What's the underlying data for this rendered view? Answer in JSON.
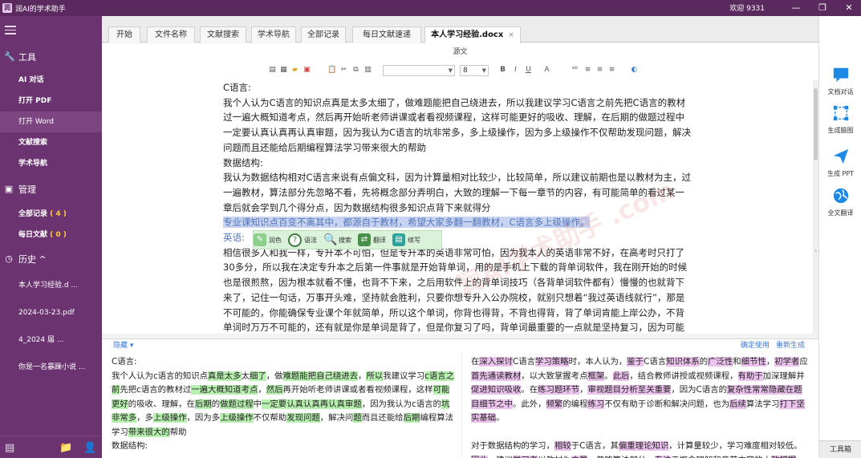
{
  "app": {
    "title": "润AI的学术助手",
    "logo_text": "润",
    "welcome": "欢迎 9331"
  },
  "sidebar": {
    "tools_header": "工具",
    "tools": [
      "AI 对话",
      "打开 PDF",
      "打开 Word",
      "文献搜索",
      "学术导航"
    ],
    "manage_header": "管理",
    "manage": [
      {
        "label": "全部记录",
        "count": "( 4 )"
      },
      {
        "label": "每日文献",
        "count": "( 0 )"
      }
    ],
    "history_header": "历史 ^",
    "history": [
      "本人学习经验.d ...",
      "2024-03-23.pdf",
      "4_2024 届 ...",
      "你是一名暴躁小说 ..."
    ]
  },
  "tabs": [
    {
      "label": "开始"
    },
    {
      "label": "文件名称"
    },
    {
      "label": "文献搜索"
    },
    {
      "label": "学术导航"
    },
    {
      "label": "全部记录"
    },
    {
      "label": "每日文献速递"
    },
    {
      "label": "本人学习经验.docx",
      "active": true,
      "close": "×"
    }
  ],
  "editor": {
    "source_label": "源文",
    "font_size": "8",
    "paragraphs": [
      "C语言:",
      "我个人认为C语言的知识点真是太多太细了，做难题能把自己绕进去，所以我建议学习C语言之前先把C语言的教材过一遍大概知道考点，然后再开始听老师讲课或者看视频课程，这样可能更好的吸收、理解，在后期的做题过程中一定要认真认真再认真审题，因为我认为C语言的坑非常多，多上级操作，因为多上级操作不仅帮助发现问题，解决问题而且还能给后期编程算法学习带来很大的帮助",
      "数据结构:",
      "我认为数据结构相对C语言来说有点偏文科，因为计算量相对比较少，比较简单，所以建议前期也是以教材为主，过一遍教材，算法部分先忽略不看，先将概念部分弄明白，大致的理解一下每一章节的内容，有可能简单的看过某一章后就会学到几个得分点，因为数据结构很多知识点背下来就得分"
    ],
    "selected": "专业课知识点百变不离其中，都源自于教材，希望大家多翻一翻教材，C语言多上级操作。",
    "english_heading": "英语:",
    "english_body": "相信很多人和我一样，专升本不可怕，但是专升本的英语非常可怕，因为我本人的英语非常不好，在高考时只打了30多分，所以我在决定专升本之后第一件事就是开始背单词，用的是手机上下载的背单词软件，我在刚开始的时候也是很煎熬，因为根本就看不懂，也背不下来，之后用软件上的背单词技巧（各背单词软件都有）慢慢的也就背下来了，记住一句话，万事开头难，坚持就会胜利，只要你想专升入公办院校，就别只想着“我过英语线就行”，那是不可能的，你能确保专业课个年就简单，所以这个单词，你背也得背，不背也得背，背了单词肯能上岸公办，不背单词时万万不可能的，还有就是你是单词是背了，但是你复习了吗，背单词最重要的一点就是坚持复习，因为可能今天背下来的单词",
    "watermark": "润AI学术助手 .com"
  },
  "popup": [
    {
      "label": "润色",
      "icon": "polish-icon",
      "color": "#6fbf6f"
    },
    {
      "label": "语法",
      "icon": "grammar-icon",
      "color": "#4a8f4a"
    },
    {
      "label": "搜索",
      "icon": "search-icon",
      "color": "#4a8f4a"
    },
    {
      "label": "翻译",
      "icon": "translate-icon",
      "color": "#4a8f4a"
    },
    {
      "label": "续写",
      "icon": "continue-icon",
      "color": "#2aa39a"
    }
  ],
  "compare": {
    "hide": "隐藏 ▾",
    "confirm": "确定使用",
    "regen": "重新生成"
  },
  "rpanel": {
    "items": [
      {
        "label": "文档对话",
        "icon": "chat-icon"
      },
      {
        "label": "生成脑图",
        "icon": "mindmap-icon"
      },
      {
        "label": "生成 PPT",
        "icon": "send-icon"
      },
      {
        "label": "全文翻译",
        "icon": "globe-icon"
      }
    ],
    "toolbox": "工具箱"
  },
  "colors": {
    "sidebar": "#6b3471",
    "titlebar": "#5a2a5e",
    "accent": "#3a7bd5",
    "green_highlight": "#b8f0b0",
    "pink_highlight": "#ecc3ee"
  }
}
